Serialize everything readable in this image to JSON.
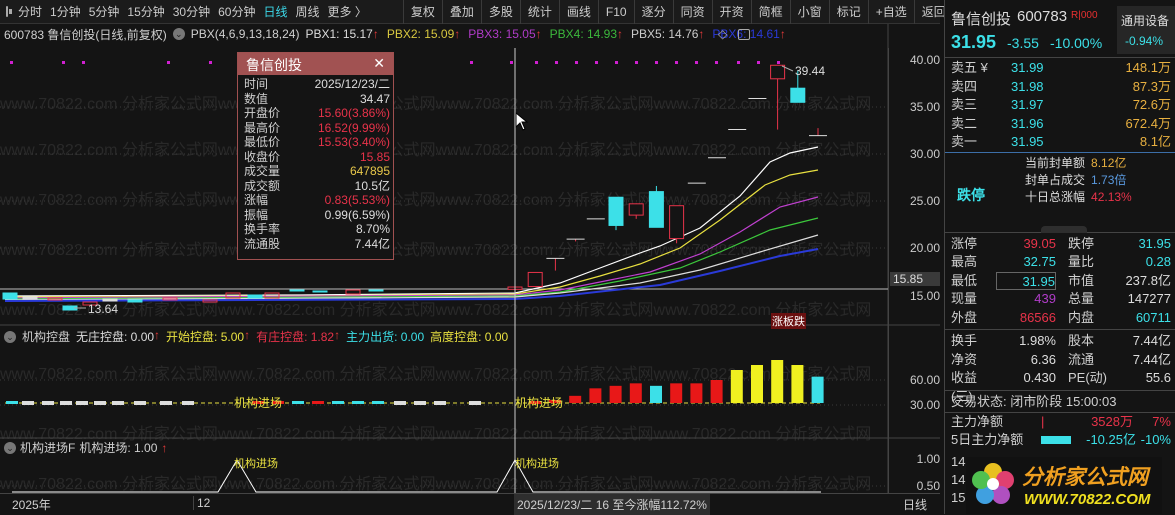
{
  "toolbar": {
    "periods": [
      "分时",
      "1分钟",
      "5分钟",
      "15分钟",
      "30分钟",
      "60分钟",
      "日线",
      "周线",
      "更多 〉"
    ],
    "active_period": "日线",
    "buttons": [
      "复权",
      "叠加",
      "多股",
      "统计",
      "画线",
      "F10",
      "逐分",
      "同资",
      "开资",
      "简框",
      "小窗",
      "标记",
      "+自选",
      "返回"
    ]
  },
  "info": {
    "title": "600783 鲁信创投(日线,前复权)",
    "indicator": "PBX(4,6,9,13,18,24)",
    "pbx": [
      {
        "label": "PBX1: 15.17",
        "color": "#dddddd"
      },
      {
        "label": "PBX2: 15.09",
        "color": "#d8c840"
      },
      {
        "label": "PBX3: 15.05",
        "color": "#b03cc8"
      },
      {
        "label": "PBX4: 14.93",
        "color": "#3cb83c"
      },
      {
        "label": "PBX5: 14.76",
        "color": "#cccccc"
      },
      {
        "label": "PBX6: 14.61",
        "color": "#2a3ad8"
      }
    ]
  },
  "watermark": "www.70822.com 分析家公式网www.70822.com 分析家公式网www.70822.com 分析家公式网www.70822.com 分析家公式网",
  "price_axis": [
    "40.00",
    "35.00",
    "30.00",
    "25.00",
    "20.00",
    "15.00"
  ],
  "current_price_tag": "15.85",
  "annotations": {
    "high": "39.44",
    "low": "13.64",
    "limit": "涨板跌"
  },
  "tooltip": {
    "title": "鲁信创投",
    "close": "✕",
    "rows": [
      {
        "k": "时间",
        "v": "2025/12/23/二",
        "c": "wht"
      },
      {
        "k": "数值",
        "v": "34.47",
        "c": "wht"
      },
      {
        "k": "开盘价",
        "v": "15.60(3.86%)",
        "c": "red"
      },
      {
        "k": "最高价",
        "v": "16.52(9.99%)",
        "c": "red"
      },
      {
        "k": "最低价",
        "v": "15.53(3.40%)",
        "c": "red"
      },
      {
        "k": "收盘价",
        "v": "15.85",
        "c": "red"
      },
      {
        "k": "成交量",
        "v": "647895",
        "c": "yel"
      },
      {
        "k": "成交额",
        "v": "10.5亿",
        "c": "wht"
      },
      {
        "k": "涨幅",
        "v": "0.83(5.53%)",
        "c": "red"
      },
      {
        "k": "振幅",
        "v": "0.99(6.59%)",
        "c": "wht"
      },
      {
        "k": "换手率",
        "v": "8.70%",
        "c": "wht"
      },
      {
        "k": "流通股",
        "v": "7.44亿",
        "c": "wht"
      }
    ]
  },
  "candles": [
    {
      "o": 15.6,
      "h": 16.52,
      "l": 15.53,
      "c": 15.85
    },
    {
      "o": 15.9,
      "h": 17.4,
      "l": 15.9,
      "c": 17.4
    },
    {
      "o": 18.9,
      "h": 18.9,
      "l": 17.6,
      "c": 18.9
    },
    {
      "o": 20.95,
      "h": 20.95,
      "l": 20.7,
      "c": 20.95
    },
    {
      "o": 23.1,
      "h": 23.1,
      "l": 23.1,
      "c": 23.1
    },
    {
      "o": 25.4,
      "h": 25.4,
      "l": 21.9,
      "c": 22.4
    },
    {
      "o": 23.5,
      "h": 24.7,
      "l": 23.1,
      "c": 24.7
    },
    {
      "o": 26.0,
      "h": 26.6,
      "l": 22.2,
      "c": 22.2
    },
    {
      "o": 21.0,
      "h": 24.5,
      "l": 20.5,
      "c": 24.5
    },
    {
      "o": 26.9,
      "h": 26.9,
      "l": 26.9,
      "c": 26.9
    },
    {
      "o": 29.6,
      "h": 29.6,
      "l": 29.6,
      "c": 29.6
    },
    {
      "o": 32.6,
      "h": 32.6,
      "l": 32.6,
      "c": 32.6
    },
    {
      "o": 35.9,
      "h": 35.9,
      "l": 35.9,
      "c": 35.9
    },
    {
      "o": 38.0,
      "h": 39.44,
      "l": 32.6,
      "c": 39.44
    },
    {
      "o": 37.0,
      "h": 38.9,
      "l": 35.5,
      "c": 35.5
    },
    {
      "o": 31.95,
      "h": 32.75,
      "l": 31.95,
      "c": 31.95
    }
  ],
  "panel2": {
    "name": "机构控盘",
    "items": [
      {
        "label": "无庄控盘: 0.00",
        "color": "#dddddd",
        "arrow": true
      },
      {
        "label": "开始控盘: 5.00",
        "color": "#e8e040",
        "arrow": true
      },
      {
        "label": "有庄控盘: 1.82",
        "color": "#e8334a",
        "arrow": true
      },
      {
        "label": "主力出货: 0.00",
        "color": "#3ce0e8",
        "arrow": false
      },
      {
        "label": "高度控盘: 0.00",
        "color": "#e8e040",
        "arrow": false
      }
    ],
    "axis": [
      "60.00",
      "30.00"
    ],
    "signal": "机构进场",
    "bars": [
      {
        "v": 36,
        "t": "r"
      },
      {
        "v": 41,
        "t": "r"
      },
      {
        "v": 50,
        "t": "r"
      },
      {
        "v": 53,
        "t": "r"
      },
      {
        "v": 56,
        "t": "r"
      },
      {
        "v": 53,
        "t": "c"
      },
      {
        "v": 56,
        "t": "r"
      },
      {
        "v": 56,
        "t": "r"
      },
      {
        "v": 60,
        "t": "r"
      },
      {
        "v": 72,
        "t": "y"
      },
      {
        "v": 78,
        "t": "y"
      },
      {
        "v": 84,
        "t": "y"
      },
      {
        "v": 78,
        "t": "y"
      },
      {
        "v": 64,
        "t": "c"
      }
    ]
  },
  "panel3": {
    "name": "机构进场F",
    "value": "机构进场: 1.00",
    "axis": [
      "1.00",
      "0.50"
    ],
    "signal": "机构进场"
  },
  "bottom_axis": {
    "year": "2025年",
    "month": "12",
    "cursor": "2025/12/23/二 16 至今涨幅112.72%",
    "period": "日线"
  },
  "quote": {
    "name": "鲁信创投",
    "code": "600783",
    "tag": "R|000",
    "industry": "通用设备",
    "industry_change": "-0.94%",
    "price": "31.95",
    "change": "-3.55",
    "change_pct": "-10.00%",
    "asks": [
      {
        "k": "卖五 ¥",
        "p": "31.99",
        "v": "148.1万"
      },
      {
        "k": "卖四",
        "p": "31.98",
        "v": "87.3万"
      },
      {
        "k": "卖三",
        "p": "31.97",
        "v": "72.6万"
      },
      {
        "k": "卖二",
        "p": "31.96",
        "v": "672.4万"
      },
      {
        "k": "卖一",
        "p": "31.95",
        "v": "8.1亿"
      }
    ],
    "limit_status": "跌停",
    "limit_info": [
      {
        "k": "当前封单额",
        "v": "8.12亿",
        "c": "orange"
      },
      {
        "k": "封单占成交",
        "v": "1.73倍",
        "c": "blu"
      },
      {
        "k": "十日总涨幅",
        "v": "42.13%",
        "c": "red"
      }
    ],
    "stats1": [
      [
        "涨停",
        "39.05",
        "red",
        "跌停",
        "31.95",
        "cyan"
      ],
      [
        "最高",
        "32.75",
        "cyan",
        "量比",
        "0.28",
        "cyan"
      ],
      [
        "最低",
        "31.95",
        "cyan",
        "市值",
        "237.8亿",
        "wht"
      ],
      [
        "现量",
        "439",
        "pur",
        "总量",
        "147277",
        "wht"
      ],
      [
        "外盘",
        "86566",
        "red",
        "内盘",
        "60711",
        "cyan"
      ]
    ],
    "stats2": [
      [
        "换手",
        "1.98%",
        "wht",
        "股本",
        "7.44亿",
        "wht"
      ],
      [
        "净资",
        "6.36",
        "wht",
        "流通",
        "7.44亿",
        "wht"
      ],
      [
        "收益(三)",
        "0.430",
        "wht",
        "PE(动)",
        "55.6",
        "wht"
      ]
    ],
    "trade_status": "交易状态: 闭市阶段 15:00:03",
    "main_net": {
      "k": "主力净额",
      "v": "3528万",
      "pct": "7%"
    },
    "main_net5": {
      "k": "5日主力净额",
      "v": "-10.25亿",
      "pct": "-10%"
    },
    "rows_partial": [
      "14",
      "14",
      "15"
    ]
  },
  "logo": {
    "name": "分析家公式网",
    "url": "WWW.70822.COM"
  }
}
